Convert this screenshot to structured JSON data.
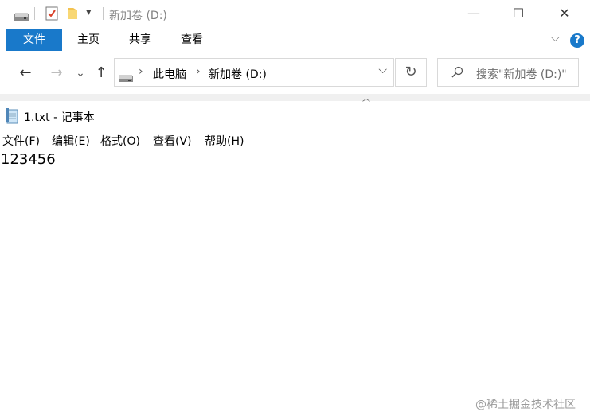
{
  "explorer": {
    "title": "新加卷 (D:)",
    "qat_dropdown_glyph": "▾",
    "window_controls": {
      "minimize": "—",
      "maximize": "☐",
      "close": "✕"
    },
    "tabs": [
      {
        "label": "文件",
        "active": true
      },
      {
        "label": "主页"
      },
      {
        "label": "共享"
      },
      {
        "label": "查看"
      }
    ],
    "address": {
      "crumbs": [
        "此电脑",
        "新加卷 (D:)"
      ],
      "separator": "›",
      "dropdown_glyph": "⌵"
    },
    "refresh_glyph": "↻",
    "search_placeholder": "搜索\"新加卷 (D:)\"",
    "help_glyph": "?",
    "ribbon_collapse_glyph": "⌵",
    "nav": {
      "back": "←",
      "forward": "→",
      "recent": "⌄",
      "up": "↑"
    },
    "accent_color": "#1979ca"
  },
  "notepad": {
    "title": "1.txt - 记事本",
    "menu": [
      {
        "label": "文件(",
        "key": "F",
        "end": ")"
      },
      {
        "label": "编辑(",
        "key": "E",
        "end": ")"
      },
      {
        "label": "格式(",
        "key": "O",
        "end": ")"
      },
      {
        "label": "查看(",
        "key": "V",
        "end": ")"
      },
      {
        "label": "帮助(",
        "key": "H",
        "end": ")"
      }
    ],
    "content": "123456"
  },
  "watermark": "@稀土掘金技术社区"
}
